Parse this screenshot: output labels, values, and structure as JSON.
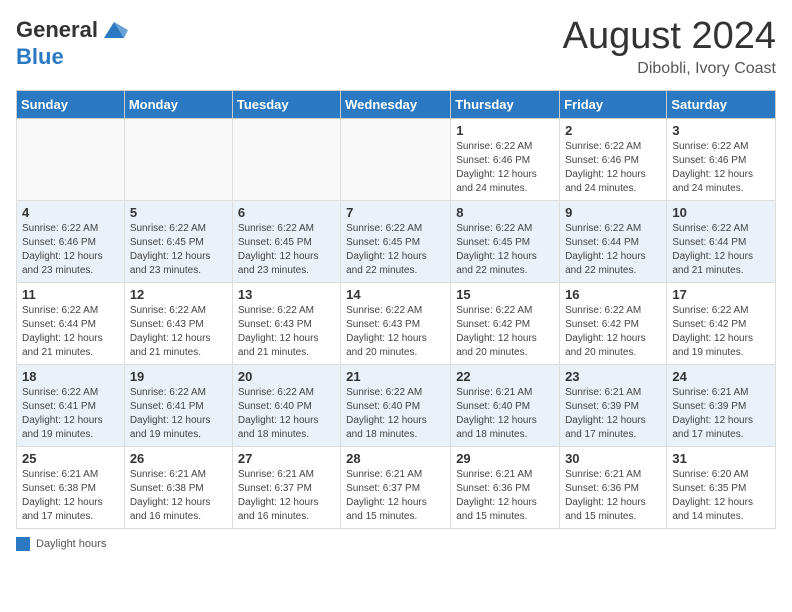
{
  "header": {
    "logo_general": "General",
    "logo_blue": "Blue",
    "month_year": "August 2024",
    "location": "Dibobli, Ivory Coast"
  },
  "days_of_week": [
    "Sunday",
    "Monday",
    "Tuesday",
    "Wednesday",
    "Thursday",
    "Friday",
    "Saturday"
  ],
  "weeks": [
    [
      {
        "day": "",
        "info": ""
      },
      {
        "day": "",
        "info": ""
      },
      {
        "day": "",
        "info": ""
      },
      {
        "day": "",
        "info": ""
      },
      {
        "day": "1",
        "info": "Sunrise: 6:22 AM\nSunset: 6:46 PM\nDaylight: 12 hours\nand 24 minutes."
      },
      {
        "day": "2",
        "info": "Sunrise: 6:22 AM\nSunset: 6:46 PM\nDaylight: 12 hours\nand 24 minutes."
      },
      {
        "day": "3",
        "info": "Sunrise: 6:22 AM\nSunset: 6:46 PM\nDaylight: 12 hours\nand 24 minutes."
      }
    ],
    [
      {
        "day": "4",
        "info": "Sunrise: 6:22 AM\nSunset: 6:46 PM\nDaylight: 12 hours\nand 23 minutes."
      },
      {
        "day": "5",
        "info": "Sunrise: 6:22 AM\nSunset: 6:45 PM\nDaylight: 12 hours\nand 23 minutes."
      },
      {
        "day": "6",
        "info": "Sunrise: 6:22 AM\nSunset: 6:45 PM\nDaylight: 12 hours\nand 23 minutes."
      },
      {
        "day": "7",
        "info": "Sunrise: 6:22 AM\nSunset: 6:45 PM\nDaylight: 12 hours\nand 22 minutes."
      },
      {
        "day": "8",
        "info": "Sunrise: 6:22 AM\nSunset: 6:45 PM\nDaylight: 12 hours\nand 22 minutes."
      },
      {
        "day": "9",
        "info": "Sunrise: 6:22 AM\nSunset: 6:44 PM\nDaylight: 12 hours\nand 22 minutes."
      },
      {
        "day": "10",
        "info": "Sunrise: 6:22 AM\nSunset: 6:44 PM\nDaylight: 12 hours\nand 21 minutes."
      }
    ],
    [
      {
        "day": "11",
        "info": "Sunrise: 6:22 AM\nSunset: 6:44 PM\nDaylight: 12 hours\nand 21 minutes."
      },
      {
        "day": "12",
        "info": "Sunrise: 6:22 AM\nSunset: 6:43 PM\nDaylight: 12 hours\nand 21 minutes."
      },
      {
        "day": "13",
        "info": "Sunrise: 6:22 AM\nSunset: 6:43 PM\nDaylight: 12 hours\nand 21 minutes."
      },
      {
        "day": "14",
        "info": "Sunrise: 6:22 AM\nSunset: 6:43 PM\nDaylight: 12 hours\nand 20 minutes."
      },
      {
        "day": "15",
        "info": "Sunrise: 6:22 AM\nSunset: 6:42 PM\nDaylight: 12 hours\nand 20 minutes."
      },
      {
        "day": "16",
        "info": "Sunrise: 6:22 AM\nSunset: 6:42 PM\nDaylight: 12 hours\nand 20 minutes."
      },
      {
        "day": "17",
        "info": "Sunrise: 6:22 AM\nSunset: 6:42 PM\nDaylight: 12 hours\nand 19 minutes."
      }
    ],
    [
      {
        "day": "18",
        "info": "Sunrise: 6:22 AM\nSunset: 6:41 PM\nDaylight: 12 hours\nand 19 minutes."
      },
      {
        "day": "19",
        "info": "Sunrise: 6:22 AM\nSunset: 6:41 PM\nDaylight: 12 hours\nand 19 minutes."
      },
      {
        "day": "20",
        "info": "Sunrise: 6:22 AM\nSunset: 6:40 PM\nDaylight: 12 hours\nand 18 minutes."
      },
      {
        "day": "21",
        "info": "Sunrise: 6:22 AM\nSunset: 6:40 PM\nDaylight: 12 hours\nand 18 minutes."
      },
      {
        "day": "22",
        "info": "Sunrise: 6:21 AM\nSunset: 6:40 PM\nDaylight: 12 hours\nand 18 minutes."
      },
      {
        "day": "23",
        "info": "Sunrise: 6:21 AM\nSunset: 6:39 PM\nDaylight: 12 hours\nand 17 minutes."
      },
      {
        "day": "24",
        "info": "Sunrise: 6:21 AM\nSunset: 6:39 PM\nDaylight: 12 hours\nand 17 minutes."
      }
    ],
    [
      {
        "day": "25",
        "info": "Sunrise: 6:21 AM\nSunset: 6:38 PM\nDaylight: 12 hours\nand 17 minutes."
      },
      {
        "day": "26",
        "info": "Sunrise: 6:21 AM\nSunset: 6:38 PM\nDaylight: 12 hours\nand 16 minutes."
      },
      {
        "day": "27",
        "info": "Sunrise: 6:21 AM\nSunset: 6:37 PM\nDaylight: 12 hours\nand 16 minutes."
      },
      {
        "day": "28",
        "info": "Sunrise: 6:21 AM\nSunset: 6:37 PM\nDaylight: 12 hours\nand 15 minutes."
      },
      {
        "day": "29",
        "info": "Sunrise: 6:21 AM\nSunset: 6:36 PM\nDaylight: 12 hours\nand 15 minutes."
      },
      {
        "day": "30",
        "info": "Sunrise: 6:21 AM\nSunset: 6:36 PM\nDaylight: 12 hours\nand 15 minutes."
      },
      {
        "day": "31",
        "info": "Sunrise: 6:20 AM\nSunset: 6:35 PM\nDaylight: 12 hours\nand 14 minutes."
      }
    ]
  ],
  "footer": {
    "daylight_label": "Daylight hours"
  }
}
